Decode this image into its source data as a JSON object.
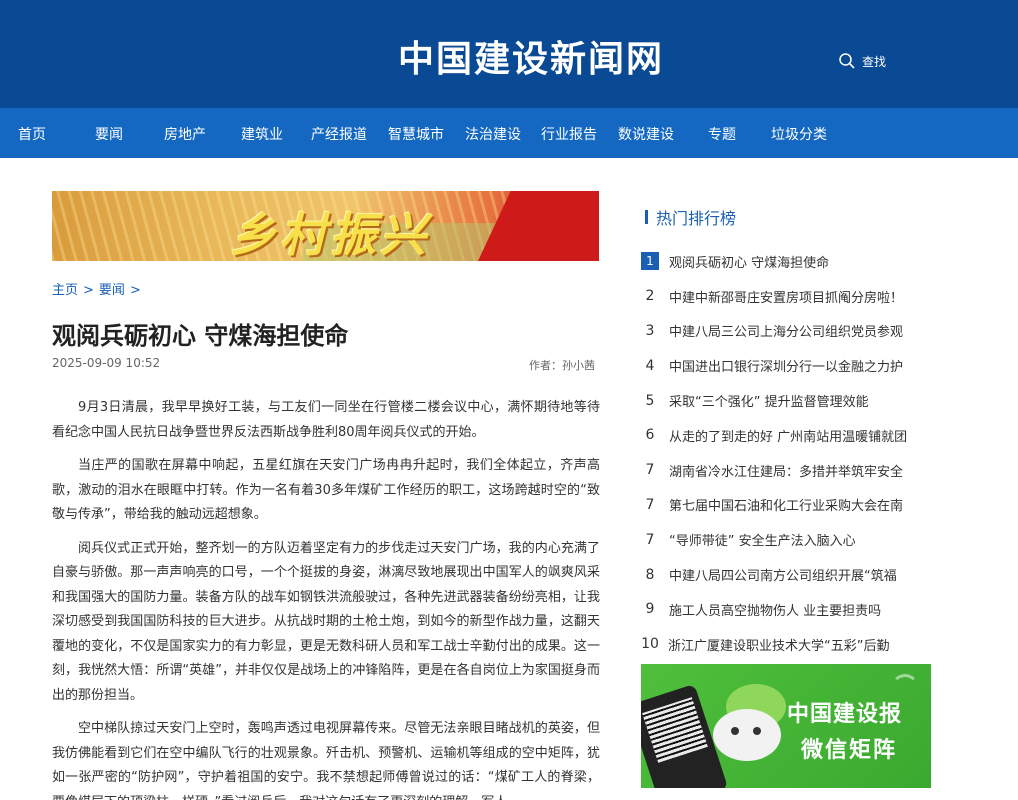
{
  "header": {
    "site_title": "中国建设新闻网",
    "search_label": "查找",
    "bg_color": "#0a4a94"
  },
  "nav": {
    "items": [
      "首页",
      "要闻",
      "房地产",
      "建筑业",
      "产经报道",
      "智慧城市",
      "法治建设",
      "行业报告",
      "数说建设",
      "专题",
      "垃圾分类"
    ],
    "bg_color": "#1468c2"
  },
  "banner": {
    "text": "乡村振兴"
  },
  "breadcrumb": {
    "home": "主页",
    "section": "要闻",
    "separator": ">"
  },
  "article": {
    "title": "观阅兵砺初心 守煤海担使命",
    "date": "2025-09-09 10:52",
    "author": "作者：孙小茜",
    "paragraphs": [
      "9月3日清晨，我早早换好工装，与工友们一同坐在行管楼二楼会议中心，满怀期待地等待看纪念中国人民抗日战争暨世界反法西斯战争胜利80周年阅兵仪式的开始。",
      "当庄严的国歌在屏幕中响起，五星红旗在天安门广场冉冉升起时，我们全体起立，齐声高歌，激动的泪水在眼眶中打转。作为一名有着30多年煤矿工作经历的职工，这场跨越时空的“致敬与传承”，带给我的触动远超想象。",
      "阅兵仪式正式开始，整齐划一的方队迈着坚定有力的步伐走过天安门广场，我的内心充满了自豪与骄傲。那一声声响亮的口号，一个个挺拔的身姿，淋漓尽致地展现出中国军人的飒爽风采和我国强大的国防力量。装备方队的战车如钢铁洪流般驶过，各种先进武器装备纷纷亮相，让我深切感受到我国国防科技的巨大进步。从抗战时期的土枪土炮，到如今的新型作战力量，这翻天覆地的变化，不仅是国家实力的有力彰显，更是无数科研人员和军工战士辛勤付出的成果。这一刻，我恍然大悟：所谓“英雄”，并非仅仅是战场上的冲锋陷阵，更是在各自岗位上为家国挺身而出的那份担当。",
      "空中梯队掠过天安门上空时，轰鸣声透过电视屏幕传来。尽管无法亲眼目睹战机的英姿，但我仿佛能看到它们在空中编队飞行的壮观景象。歼击机、预警机、运输机等组成的空中矩阵，犹如一张严密的“防护网”，守护着祖国的安宁。我不禁想起师傅曾说过的话：“煤矿工人的脊梁，要像煤层下的顶梁柱一样硬。”看过阅兵后，我对这句话有了更深刻的理解。军人"
    ]
  },
  "sidebar": {
    "hot_title": "热门排行榜",
    "accent_color": "#1a5fb4",
    "hot_list": [
      {
        "rank": "1",
        "text": "观阅兵砺初心 守煤海担使命"
      },
      {
        "rank": "2",
        "text": "中建中新邵哥庄安置房项目抓阄分房啦！"
      },
      {
        "rank": "3",
        "text": "中建八局三公司上海分公司组织党员参观"
      },
      {
        "rank": "4",
        "text": "中国进出口银行深圳分行一以金融之力护"
      },
      {
        "rank": "5",
        "text": "采取“三个强化” 提升监督管理效能"
      },
      {
        "rank": "6",
        "text": "从走的了到走的好 广州南站用温暖铺就团"
      },
      {
        "rank": "7",
        "text": "湖南省冷水江住建局：多措并举筑牢安全"
      },
      {
        "rank": "7",
        "text": "第七届中国石油和化工行业采购大会在南"
      },
      {
        "rank": "7",
        "text": "“导师带徒” 安全生产法入脑入心"
      },
      {
        "rank": "8",
        "text": "中建八局四公司南方公司组织开展“筑福"
      },
      {
        "rank": "9",
        "text": "施工人员高空抛物伤人 业主要担责吗"
      },
      {
        "rank": "10",
        "text": "浙江广厦建设职业技术大学“五彩”后勤"
      }
    ],
    "promo": {
      "line1": "中国建设报",
      "line2": "微信矩阵"
    }
  }
}
